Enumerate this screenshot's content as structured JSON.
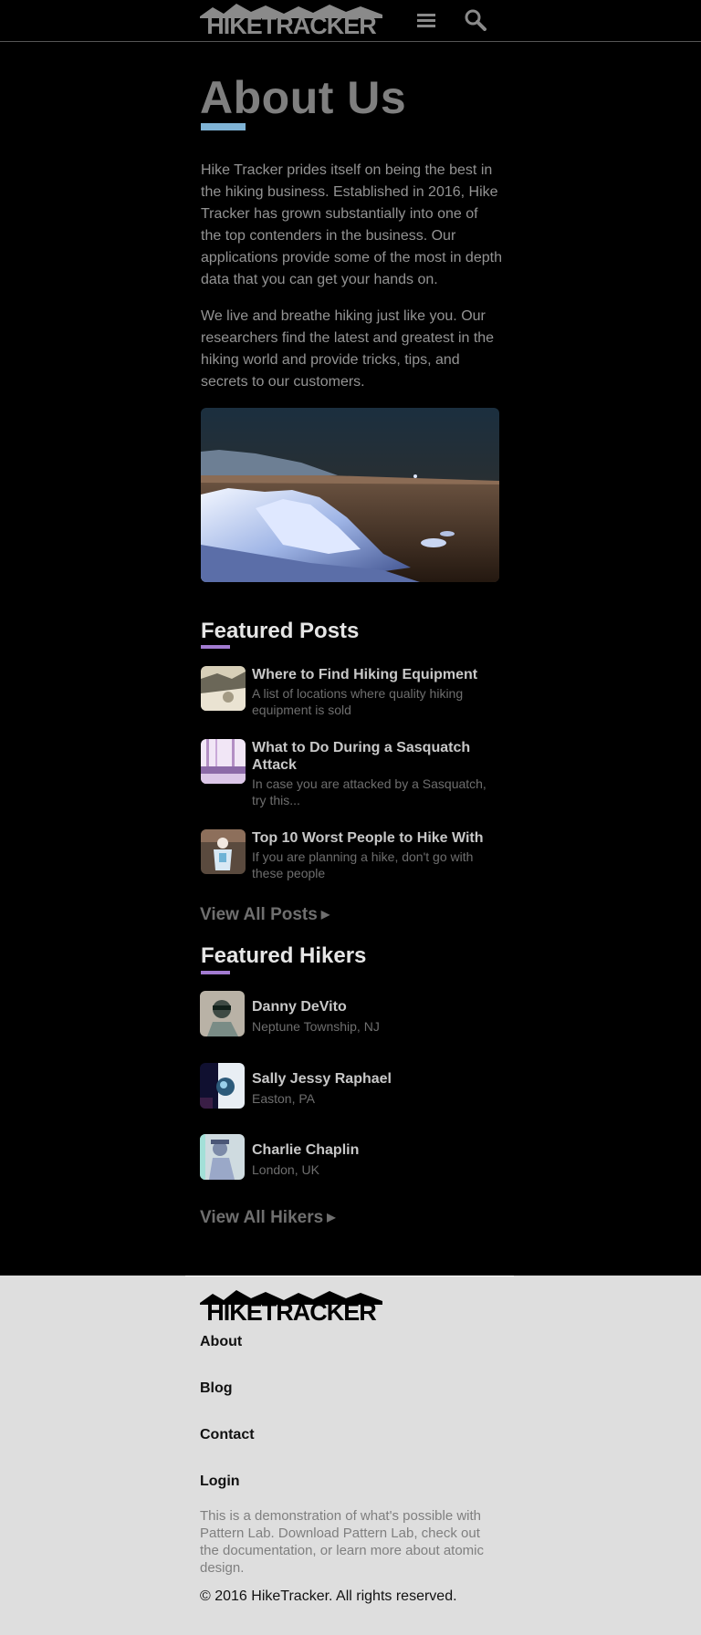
{
  "header": {
    "logo_text": "HIKETRACKER",
    "menu_icon": "hamburger-menu-icon",
    "search_icon": "search-icon"
  },
  "main": {
    "title": "About Us",
    "accent_color": "#7fb3d5",
    "paragraphs": [
      "Hike Tracker prides itself on being the best in the hiking business. Established in 2016, Hike Tracker has grown substantially into one of the top contenders in the business. Our applications provide some of the most in depth data that you can get your hands on.",
      "We live and breathe hiking just like you. Our researchers find the latest and greatest in the hiking world and provide tricks, tips, and secrets to our customers."
    ]
  },
  "featured_posts": {
    "title": "Featured Posts",
    "accent_color": "#a27bd1",
    "items": [
      {
        "title": "Where to Find Hiking Equipment",
        "excerpt": "A list of locations where quality hiking equipment is sold"
      },
      {
        "title": "What to Do During a Sasquatch Attack",
        "excerpt": "In case you are attacked by a Sasquatch, try this..."
      },
      {
        "title": "Top 10 Worst People to Hike With",
        "excerpt": "If you are planning a hike, don't go with these people"
      }
    ],
    "view_all": "View All Posts",
    "view_all_icon": "play-arrow-icon"
  },
  "featured_hikers": {
    "title": "Featured Hikers",
    "items": [
      {
        "name": "Danny DeVito",
        "location": "Neptune Township, NJ"
      },
      {
        "name": "Sally Jessy Raphael",
        "location": "Easton, PA"
      },
      {
        "name": "Charlie Chaplin",
        "location": "London, UK"
      }
    ],
    "view_all": "View All Hikers",
    "view_all_icon": "play-arrow-icon"
  },
  "footer": {
    "logo_text": "HIKETRACKER",
    "nav": [
      "About",
      "Blog",
      "Contact",
      "Login"
    ],
    "text": "This is a demonstration of what's possible with Pattern Lab. Download Pattern Lab, check out the documentation, or learn more about atomic design.",
    "copyright": "© 2016 HikeTracker. All rights reserved."
  }
}
